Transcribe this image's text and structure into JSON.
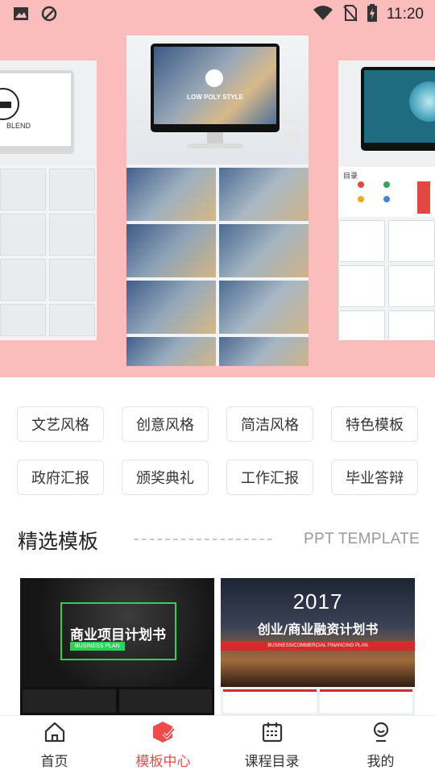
{
  "status_bar": {
    "time": "11:20",
    "icons": [
      "image-icon",
      "app-notification-icon",
      "wifi-icon",
      "no-sim-icon",
      "battery-charging-icon"
    ]
  },
  "banner": {
    "slides": [
      {
        "name": "slide-left",
        "title": "BLEND"
      },
      {
        "name": "slide-center",
        "title": "LOW POLY STYLE"
      },
      {
        "name": "slide-right",
        "title": "目录"
      }
    ],
    "colors": {
      "background": "#fbbcbc"
    }
  },
  "categories": [
    "文艺风格",
    "创意风格",
    "简洁风格",
    "特色模板",
    "政府汇报",
    "颁奖典礼",
    "工作汇报",
    "毕业答辩"
  ],
  "section": {
    "title": "精选模板",
    "subtitle": "PPT TEMPLATE"
  },
  "templates": [
    {
      "title": "商业项目计划书",
      "badge": "BUSINESS PLAN"
    },
    {
      "year": "2017",
      "title": "创业/商业融资计划书",
      "badge": "BUSINESS/COMMERCIAL FINANCING PLAN"
    }
  ],
  "bottom_nav": {
    "items": [
      {
        "label": "首页",
        "icon": "home-icon"
      },
      {
        "label": "模板中心",
        "icon": "template-icon"
      },
      {
        "label": "课程目录",
        "icon": "calendar-icon"
      },
      {
        "label": "我的",
        "icon": "user-icon"
      }
    ],
    "active_index": 1,
    "colors": {
      "active": "#f04a4a",
      "inactive": "#333333"
    }
  }
}
